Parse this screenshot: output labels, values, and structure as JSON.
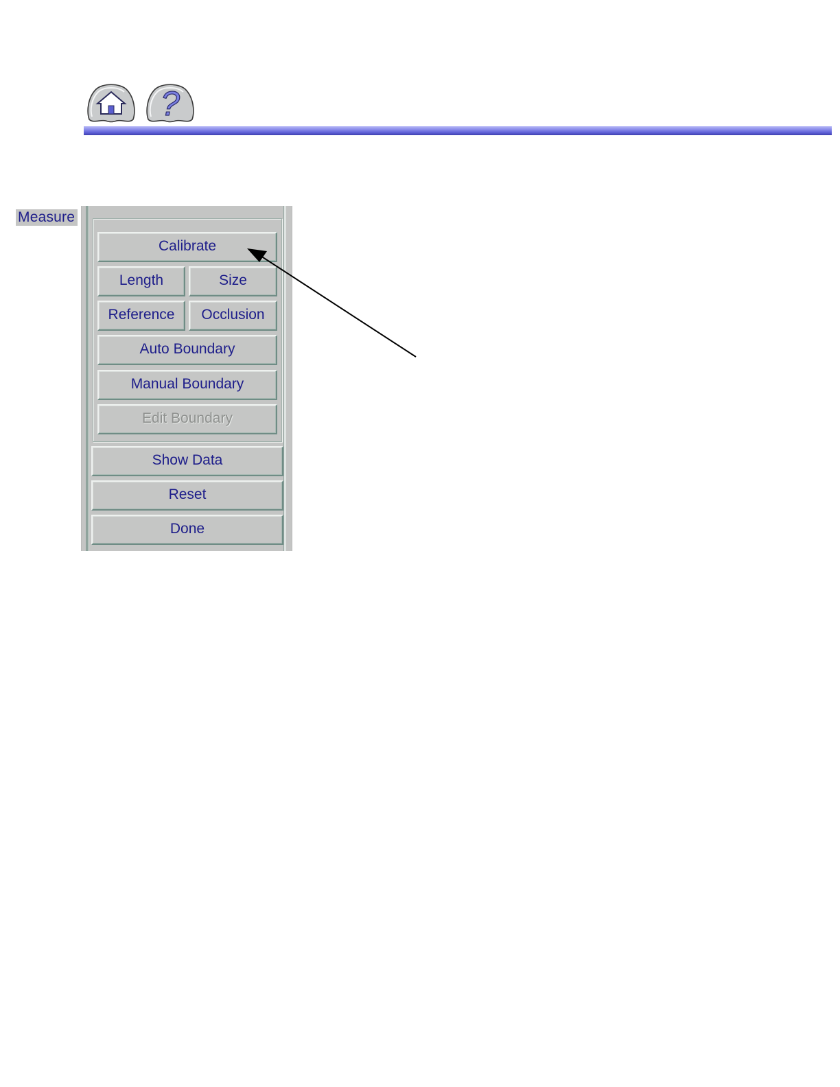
{
  "header": {
    "home_icon": "home-icon",
    "help_icon": "help-icon",
    "help_glyph": "?",
    "rule_color": "#5f61d8"
  },
  "measure_panel": {
    "group_label": "Measure",
    "buttons": {
      "calibrate": "Calibrate",
      "length": "Length",
      "size": "Size",
      "reference": "Reference",
      "occlusion": "Occlusion",
      "auto_boundary": "Auto Boundary",
      "manual_boundary": "Manual Boundary",
      "edit_boundary": "Edit Boundary"
    },
    "edit_boundary_enabled": false,
    "actions": {
      "show_data": "Show Data",
      "reset": "Reset",
      "done": "Done"
    },
    "label_color": "#1d1d8a",
    "disabled_color": "#8f918f"
  },
  "annotation": {
    "type": "arrow",
    "points_to": "Calibrate"
  }
}
